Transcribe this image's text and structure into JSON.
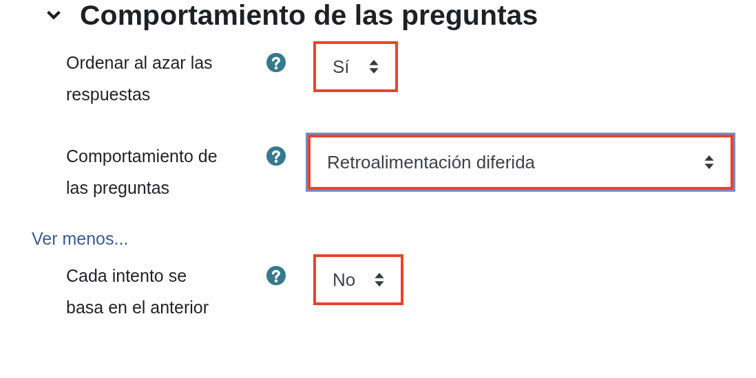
{
  "section": {
    "title": "Comportamiento de las preguntas",
    "expanded": true
  },
  "items": [
    {
      "kind": "select",
      "label": "Ordenar al azar las respuestas",
      "value": "Sí",
      "wide": false,
      "highlighted": true,
      "focused": false
    },
    {
      "kind": "select",
      "label": "Comportamiento de las preguntas",
      "value": "Retroalimentación diferida",
      "wide": true,
      "highlighted": true,
      "focused": true
    },
    {
      "kind": "link",
      "label": "Ver menos..."
    },
    {
      "kind": "select",
      "label": "Cada intento se basa en el anterior",
      "value": "No",
      "wide": false,
      "highlighted": true,
      "focused": false
    }
  ]
}
